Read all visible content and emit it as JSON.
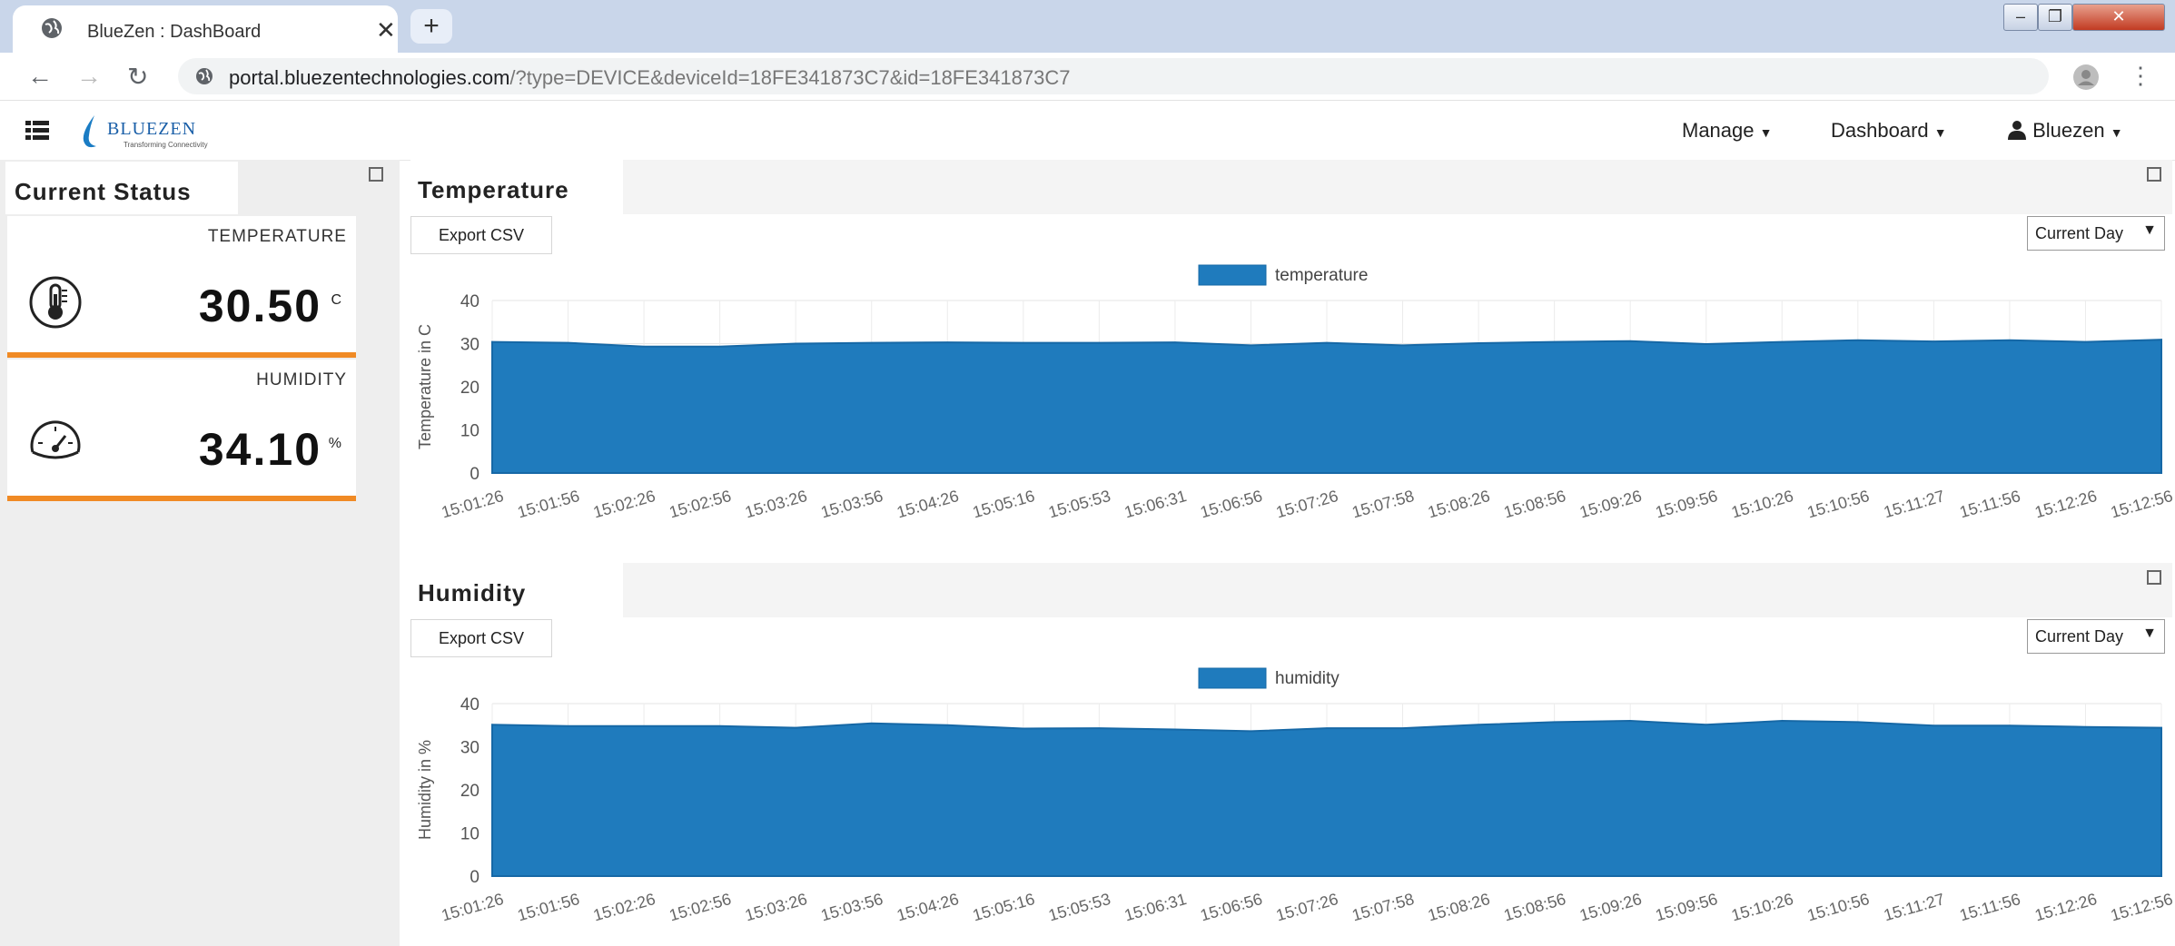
{
  "browser": {
    "tab_title": "BlueZen : DashBoard",
    "new_tab": "+",
    "close": "✕",
    "url_host": "portal.bluezentechnologies.com",
    "url_path": "/?type=DEVICE&deviceId=18FE341873C7&id=18FE341873C7"
  },
  "navbar": {
    "brand": "BLUEZEN",
    "tagline": "Transforming Connectivity",
    "manage": "Manage",
    "dashboard": "Dashboard",
    "user": "Bluezen"
  },
  "sidebar": {
    "title": "Current Status",
    "temperature": {
      "label": "TEMPERATURE",
      "value": "30.50",
      "unit": "C"
    },
    "humidity": {
      "label": "HUMIDITY",
      "value": "34.10",
      "unit": "%"
    }
  },
  "panels": {
    "temperature": {
      "title": "Temperature",
      "export": "Export CSV",
      "range": "Current Day"
    },
    "humidity": {
      "title": "Humidity",
      "export": "Export CSV",
      "range": "Current Day"
    }
  },
  "colors": {
    "series": "#1f7bbd",
    "accent": "#f08a24",
    "tabstrip": "#c9d6ea"
  },
  "chart_data": [
    {
      "type": "area",
      "legend": [
        "temperature"
      ],
      "ylabel": "Temperature in C",
      "xlabel": "",
      "ylim": [
        0,
        40
      ],
      "yticks": [
        0,
        10,
        20,
        30,
        40
      ],
      "grid": true,
      "legend_position": "top-center",
      "x": [
        "15:01:26",
        "15:01:56",
        "15:02:26",
        "15:02:56",
        "15:03:26",
        "15:03:56",
        "15:04:26",
        "15:05:16",
        "15:05:53",
        "15:06:31",
        "15:06:56",
        "15:07:26",
        "15:07:58",
        "15:08:26",
        "15:08:56",
        "15:09:26",
        "15:09:56",
        "15:10:26",
        "15:10:56",
        "15:11:27",
        "15:11:56",
        "15:12:26",
        "15:12:56"
      ],
      "series": [
        {
          "name": "temperature",
          "values": [
            30.4,
            30.2,
            29.3,
            29.3,
            30.0,
            30.2,
            30.3,
            30.2,
            30.2,
            30.3,
            29.6,
            30.2,
            29.6,
            30.1,
            30.4,
            30.6,
            29.9,
            30.4,
            30.8,
            30.5,
            30.8,
            30.4,
            30.9
          ]
        }
      ]
    },
    {
      "type": "area",
      "legend": [
        "humidity"
      ],
      "ylabel": "Humidity in %",
      "xlabel": "",
      "ylim": [
        0,
        40
      ],
      "yticks": [
        0,
        10,
        20,
        30,
        40
      ],
      "grid": true,
      "legend_position": "top-center",
      "x": [
        "15:01:26",
        "15:01:56",
        "15:02:26",
        "15:02:56",
        "15:03:26",
        "15:03:56",
        "15:04:26",
        "15:05:16",
        "15:05:53",
        "15:06:31",
        "15:06:56",
        "15:07:26",
        "15:07:58",
        "15:08:26",
        "15:08:56",
        "15:09:26",
        "15:09:56",
        "15:10:26",
        "15:10:56",
        "15:11:27",
        "15:11:56",
        "15:12:26",
        "15:12:56"
      ],
      "series": [
        {
          "name": "humidity",
          "values": [
            35.1,
            34.8,
            34.8,
            34.8,
            34.4,
            35.4,
            35.0,
            34.2,
            34.3,
            34.0,
            33.6,
            34.3,
            34.3,
            35.1,
            35.7,
            36.0,
            35.1,
            36.0,
            35.7,
            34.9,
            34.9,
            34.6,
            34.4
          ]
        }
      ]
    }
  ]
}
